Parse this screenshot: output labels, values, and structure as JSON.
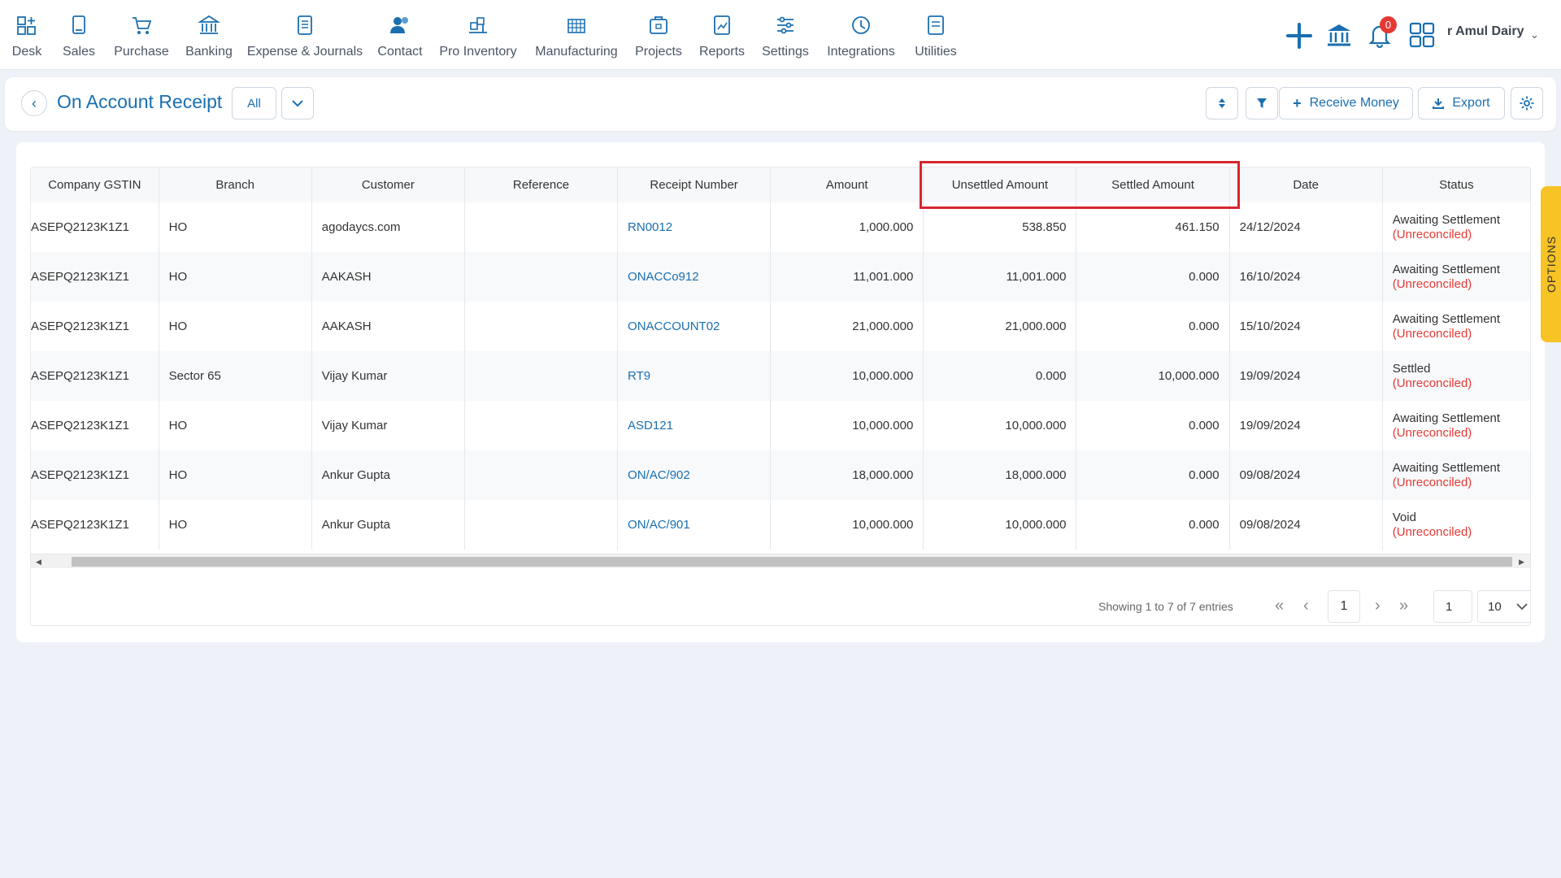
{
  "nav": {
    "items": [
      {
        "label": "Desk",
        "icon": "desk-icon"
      },
      {
        "label": "Sales",
        "icon": "sales-icon"
      },
      {
        "label": "Purchase",
        "icon": "purchase-icon"
      },
      {
        "label": "Banking",
        "icon": "banking-icon"
      },
      {
        "label": "Expense & Journals",
        "icon": "expense-icon"
      },
      {
        "label": "Contact",
        "icon": "contact-icon"
      },
      {
        "label": "Pro Inventory",
        "icon": "inventory-icon"
      },
      {
        "label": "Manufacturing",
        "icon": "manufacturing-icon"
      },
      {
        "label": "Projects",
        "icon": "projects-icon"
      },
      {
        "label": "Reports",
        "icon": "reports-icon"
      },
      {
        "label": "Settings",
        "icon": "settings-icon"
      },
      {
        "label": "Integrations",
        "icon": "integrations-icon"
      },
      {
        "label": "Utilities",
        "icon": "utilities-icon"
      }
    ],
    "notification_count": "0",
    "company_name": "r Amul Dairy"
  },
  "header": {
    "title": "On Account Receipt",
    "filter_value": "All",
    "receive_money_label": "Receive Money",
    "export_label": "Export"
  },
  "table": {
    "columns": [
      "Company GSTIN",
      "Branch",
      "Customer",
      "Reference",
      "Receipt Number",
      "Amount",
      "Unsettled Amount",
      "Settled Amount",
      "Date",
      "Status"
    ],
    "rows": [
      {
        "gstin": "ASEPQ2123K1Z1",
        "branch": "HO",
        "customer": "agodaycs.com",
        "reference": "",
        "receipt": "RN0012",
        "amount": "1,000.000",
        "unsettled": "538.850",
        "settled": "461.150",
        "date": "24/12/2024",
        "status": "Awaiting Settlement",
        "status_sub": "(Unreconciled)"
      },
      {
        "gstin": "ASEPQ2123K1Z1",
        "branch": "HO",
        "customer": "AAKASH",
        "reference": "",
        "receipt": "ONACCo912",
        "amount": "11,001.000",
        "unsettled": "11,001.000",
        "settled": "0.000",
        "date": "16/10/2024",
        "status": "Awaiting Settlement",
        "status_sub": "(Unreconciled)"
      },
      {
        "gstin": "ASEPQ2123K1Z1",
        "branch": "HO",
        "customer": "AAKASH",
        "reference": "",
        "receipt": "ONACCOUNT02",
        "amount": "21,000.000",
        "unsettled": "21,000.000",
        "settled": "0.000",
        "date": "15/10/2024",
        "status": "Awaiting Settlement",
        "status_sub": "(Unreconciled)"
      },
      {
        "gstin": "ASEPQ2123K1Z1",
        "branch": "Sector 65",
        "customer": "Vijay Kumar",
        "reference": "",
        "receipt": "RT9",
        "amount": "10,000.000",
        "unsettled": "0.000",
        "settled": "10,000.000",
        "date": "19/09/2024",
        "status": "Settled",
        "status_sub": "(Unreconciled)"
      },
      {
        "gstin": "ASEPQ2123K1Z1",
        "branch": "HO",
        "customer": "Vijay Kumar",
        "reference": "",
        "receipt": "ASD121",
        "amount": "10,000.000",
        "unsettled": "10,000.000",
        "settled": "0.000",
        "date": "19/09/2024",
        "status": "Awaiting Settlement",
        "status_sub": "(Unreconciled)"
      },
      {
        "gstin": "ASEPQ2123K1Z1",
        "branch": "HO",
        "customer": "Ankur Gupta",
        "reference": "",
        "receipt": "ON/AC/902",
        "amount": "18,000.000",
        "unsettled": "18,000.000",
        "settled": "0.000",
        "date": "09/08/2024",
        "status": "Awaiting Settlement",
        "status_sub": "(Unreconciled)"
      },
      {
        "gstin": "ASEPQ2123K1Z1",
        "branch": "HO",
        "customer": "Ankur Gupta",
        "reference": "",
        "receipt": "ON/AC/901",
        "amount": "10,000.000",
        "unsettled": "10,000.000",
        "settled": "0.000",
        "date": "09/08/2024",
        "status": "Void",
        "status_sub": "(Unreconciled)"
      }
    ]
  },
  "pagination": {
    "showing": "Showing 1 to 7 of 7 entries",
    "current_page": "1",
    "goto_page": "1",
    "page_size": "10"
  },
  "options_tab": "OPTIONS",
  "colors": {
    "brand_blue": "#1a6fb0",
    "status_red": "#e53935",
    "highlight": "#d7262f",
    "options_yellow": "#f7c325"
  }
}
